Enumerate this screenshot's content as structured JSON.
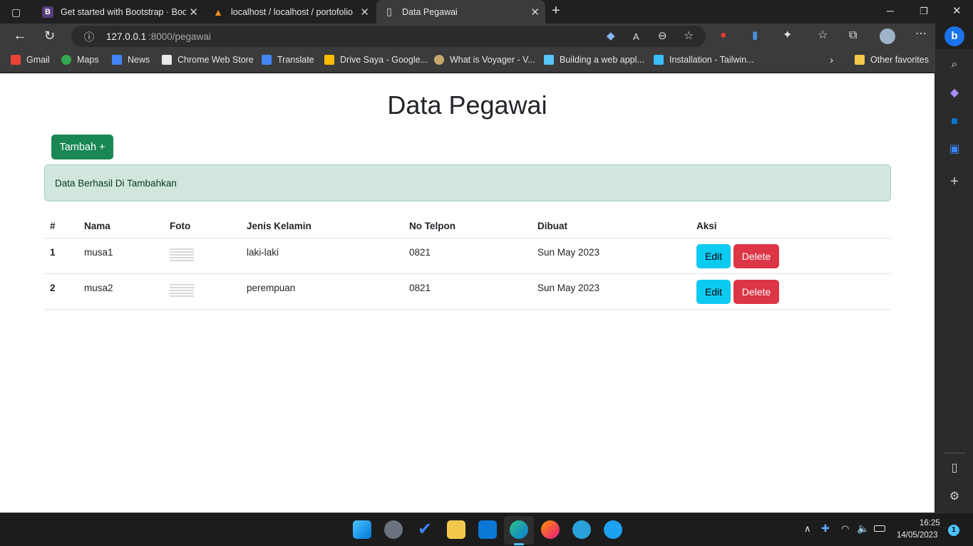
{
  "browser": {
    "tabs": [
      {
        "label": "Get started with Bootstrap · Boot",
        "favicon": "B"
      },
      {
        "label": "localhost / localhost / portofolio",
        "favicon": "pma"
      },
      {
        "label": "Data Pegawai",
        "favicon": "page"
      }
    ],
    "new_tab": "+",
    "url_host": "127.0.0.1",
    "url_rest": ":8000/pegawai",
    "bookmarks": [
      {
        "label": "Gmail",
        "color": "#ea4335"
      },
      {
        "label": "Maps",
        "color": "#34a853"
      },
      {
        "label": "News",
        "color": "#4285f4"
      },
      {
        "label": "Chrome Web Store",
        "color": "#e8e8e8"
      },
      {
        "label": "Translate",
        "color": "#4285f4"
      },
      {
        "label": "Drive Saya - Google...",
        "color": "#fbbc04"
      },
      {
        "label": "What is Voyager - V...",
        "color": "#c9a66b"
      },
      {
        "label": "Building a web appl...",
        "color": "#54c5f8"
      },
      {
        "label": "Installation - Tailwin...",
        "color": "#38bdf8"
      }
    ],
    "other_favorites": "Other favorites"
  },
  "page": {
    "title": "Data Pegawai",
    "add_button": "Tambah +",
    "alert": "Data Berhasil Di Tambahkan",
    "table": {
      "headers": [
        "#",
        "Nama",
        "Foto",
        "Jenis Kelamin",
        "No Telpon",
        "Dibuat",
        "Aksi"
      ],
      "rows": [
        {
          "no": "1",
          "nama": "musa1",
          "jenis_kelamin": "laki-laki",
          "telpon": "0821",
          "dibuat": "Sun May 2023"
        },
        {
          "no": "2",
          "nama": "musa2",
          "jenis_kelamin": "perempuan",
          "telpon": "0821",
          "dibuat": "Sun May 2023"
        }
      ],
      "edit_label": "Edit",
      "delete_label": "Delete"
    }
  },
  "taskbar": {
    "time": "16:25",
    "date": "14/05/2023",
    "notification_count": "1"
  },
  "colors": {
    "success": "#198754",
    "info": "#0dcaf0",
    "danger": "#dc3545",
    "alert_bg": "#d1e7dd"
  }
}
